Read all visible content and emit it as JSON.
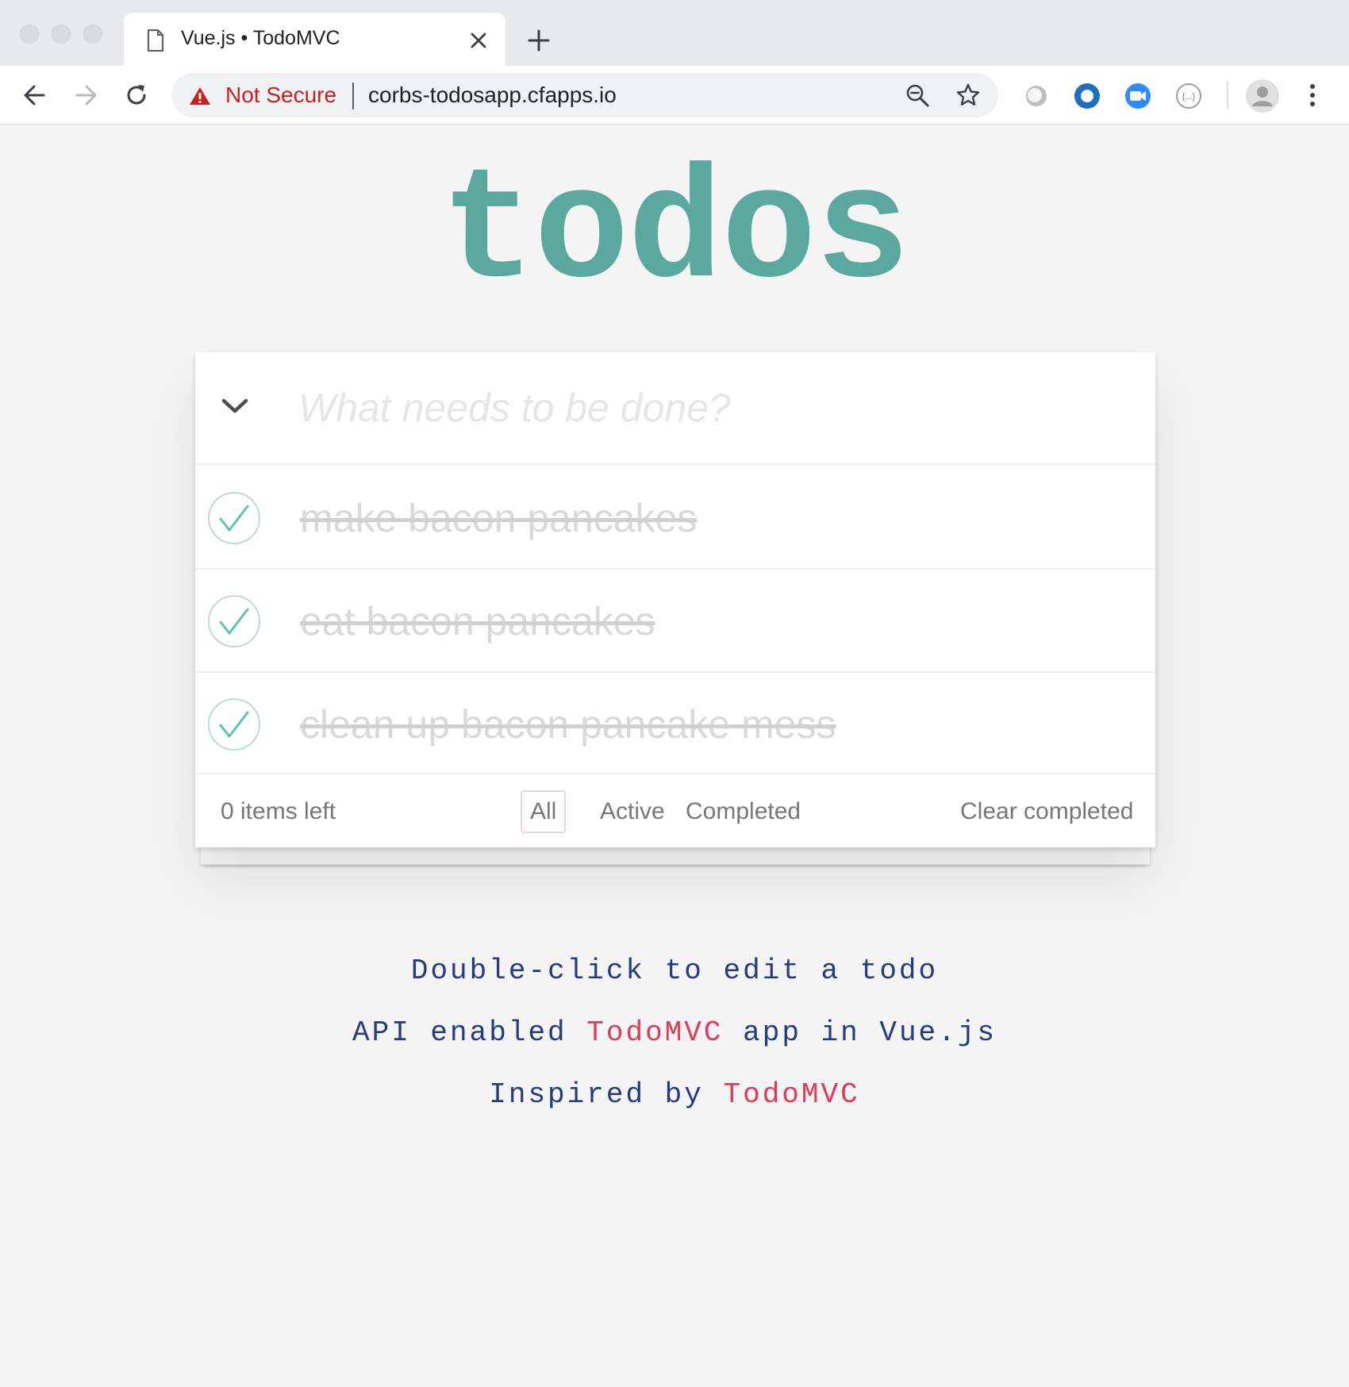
{
  "browser": {
    "tab": {
      "title": "Vue.js • TodoMVC",
      "icon": "document-icon"
    },
    "omnibox": {
      "security_label": "Not Secure",
      "url": "corbs-todosapp.cfapps.io"
    },
    "extensions": [
      "grey-circle-extension-icon",
      "blue-ring-extension-icon",
      "zoom-video-extension-icon",
      "json-viewer-extension-icon"
    ],
    "colors": {
      "tabstrip": "#e8e9ec",
      "warning": "#c5221f"
    }
  },
  "app": {
    "title": "todos",
    "new_todo_placeholder": "What needs to be done?",
    "todos": [
      {
        "title": "make bacon pancakes",
        "completed": true
      },
      {
        "title": "eat bacon pancakes",
        "completed": true
      },
      {
        "title": "clean up bacon pancake mess",
        "completed": true
      }
    ],
    "footer": {
      "items_left": "0 items left",
      "filters": [
        "All",
        "Active",
        "Completed"
      ],
      "selected_filter": "All",
      "clear_completed": "Clear completed"
    },
    "colors": {
      "title": "#5aa89e",
      "check": "#5dc2af",
      "link": "#e0395a",
      "info": "#253b80"
    }
  },
  "info": {
    "line1": "Double-click to edit a todo",
    "line2_prefix": "API enabled",
    "line2_link": "TodoMVC",
    "line2_suffix": "app in Vue.js",
    "line3_prefix": "Inspired by",
    "line3_link": "TodoMVC"
  }
}
